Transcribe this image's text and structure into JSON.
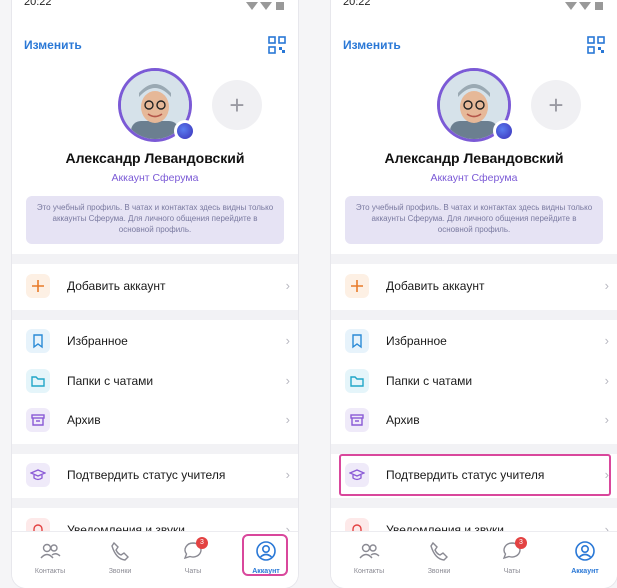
{
  "status": {
    "time": "20:22"
  },
  "header": {
    "edit_label": "Изменить",
    "qr_icon": "qr-code-icon"
  },
  "profile": {
    "name": "Александр Левандовский",
    "account_type": "Аккаунт Сферума",
    "add_icon": "+"
  },
  "notice": {
    "text": "Это учебный профиль. В чатах и контактах здесь видны только аккаунты Сферума. Для личного общения перейдите в основной профиль."
  },
  "menu": {
    "add_account": "Добавить аккаунт",
    "favorites": "Избранное",
    "folders": "Папки с чатами",
    "archive": "Архив",
    "verify_teacher": "Подтвердить статус учителя",
    "notifications": "Уведомления и звуки"
  },
  "tabs": {
    "contacts": "Контакты",
    "calls": "Звонки",
    "chats": "Чаты",
    "chats_badge": "3",
    "account": "Аккаунт"
  },
  "colors": {
    "accent": "#2a78d6",
    "purple": "#7b5ad6",
    "highlight": "#d9479c"
  }
}
